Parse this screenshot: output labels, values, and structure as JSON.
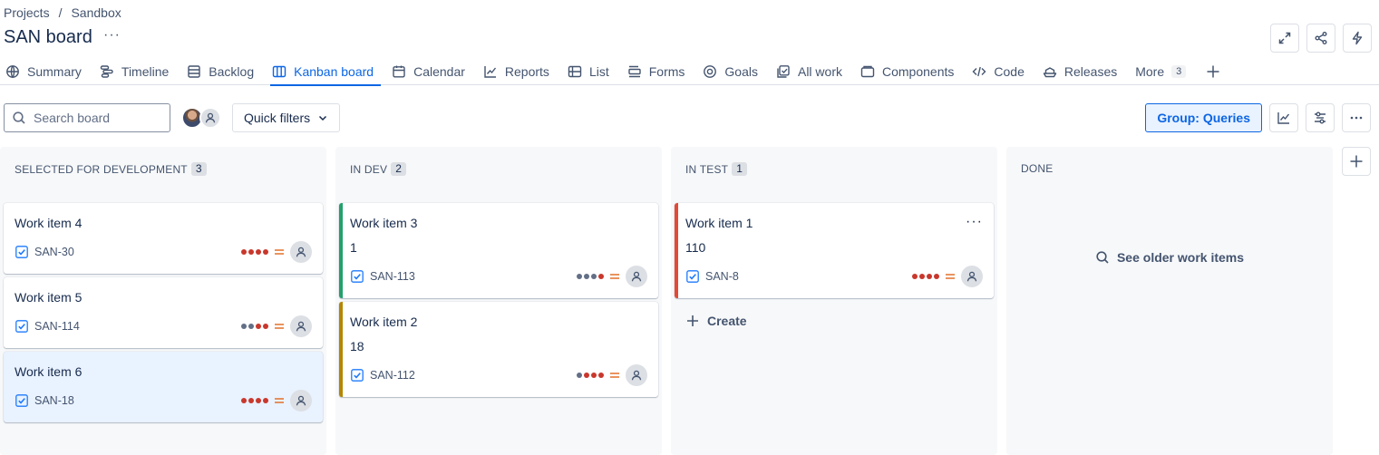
{
  "breadcrumb": {
    "parent": "Projects",
    "separator": "/",
    "current": "Sandbox"
  },
  "page": {
    "title": "SAN board",
    "more": "···"
  },
  "tabs": [
    {
      "label": "Summary",
      "icon": "globe-icon"
    },
    {
      "label": "Timeline",
      "icon": "timeline-icon"
    },
    {
      "label": "Backlog",
      "icon": "backlog-icon"
    },
    {
      "label": "Kanban board",
      "icon": "board-icon",
      "active": true
    },
    {
      "label": "Calendar",
      "icon": "calendar-icon"
    },
    {
      "label": "Reports",
      "icon": "chart-line-icon"
    },
    {
      "label": "List",
      "icon": "list-icon"
    },
    {
      "label": "Forms",
      "icon": "forms-icon"
    },
    {
      "label": "Goals",
      "icon": "goal-icon"
    },
    {
      "label": "All work",
      "icon": "all-work-icon"
    },
    {
      "label": "Components",
      "icon": "component-icon"
    },
    {
      "label": "Code",
      "icon": "code-icon"
    },
    {
      "label": "Releases",
      "icon": "ship-icon"
    }
  ],
  "tabs_more": {
    "label": "More",
    "count": "3"
  },
  "toolbar": {
    "search_placeholder": "Search board",
    "quick_filters": "Quick filters",
    "group": "Group: Queries"
  },
  "colors": {
    "accent": "#0c66e4",
    "green_bar": "#22a06b",
    "yellow_bar": "#b38600",
    "red_bar": "#e34935",
    "priority": "#e2702a",
    "dot_red": "#c9372c"
  },
  "columns": [
    {
      "name": "SELECTED FOR DEVELOPMENT",
      "count": "3",
      "cards": [
        {
          "title": "Work item 4",
          "key": "SAN-30",
          "dots": [
            1,
            1,
            1,
            1
          ]
        },
        {
          "title": "Work item 5",
          "key": "SAN-114",
          "dots": [
            0,
            0,
            1,
            1
          ]
        },
        {
          "title": "Work item 6",
          "key": "SAN-18",
          "dots": [
            1,
            1,
            1,
            1
          ],
          "selected": true
        }
      ]
    },
    {
      "name": "IN DEV",
      "count": "2",
      "cards": [
        {
          "title": "Work item 3",
          "sub": "1",
          "key": "SAN-113",
          "dots": [
            0,
            0,
            0,
            1
          ],
          "bar": "#22a06b"
        },
        {
          "title": "Work item 2",
          "sub": "18",
          "key": "SAN-112",
          "dots": [
            0,
            1,
            1,
            1
          ],
          "bar": "#b38600"
        }
      ]
    },
    {
      "name": "IN TEST",
      "count": "1",
      "cards": [
        {
          "title": "Work item 1",
          "sub": "110",
          "key": "SAN-8",
          "dots": [
            1,
            1,
            1,
            1
          ],
          "bar": "#e34935",
          "more": "···"
        }
      ],
      "create": "Create"
    },
    {
      "name": "DONE",
      "cards": [],
      "older": "See older work items"
    }
  ]
}
